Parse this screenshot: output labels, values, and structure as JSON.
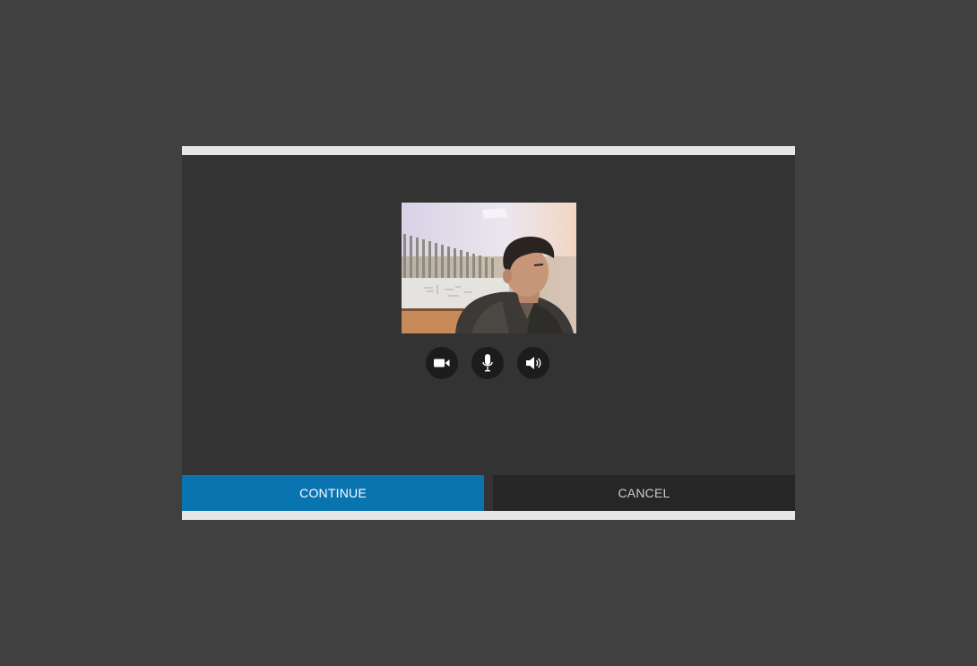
{
  "dialog": {
    "controls": [
      {
        "name": "camera-toggle",
        "icon": "video-camera-icon"
      },
      {
        "name": "microphone-toggle",
        "icon": "microphone-icon"
      },
      {
        "name": "speaker-toggle",
        "icon": "speaker-icon"
      }
    ],
    "continue_label": "CONTINUE",
    "cancel_label": "CANCEL"
  },
  "colors": {
    "page_background": "#404040",
    "dialog_body": "#333333",
    "dialog_frame": "#e6e6e6",
    "continue_button": "#0a74b1",
    "cancel_button": "#262626",
    "control_button": "#1c1c1c"
  }
}
